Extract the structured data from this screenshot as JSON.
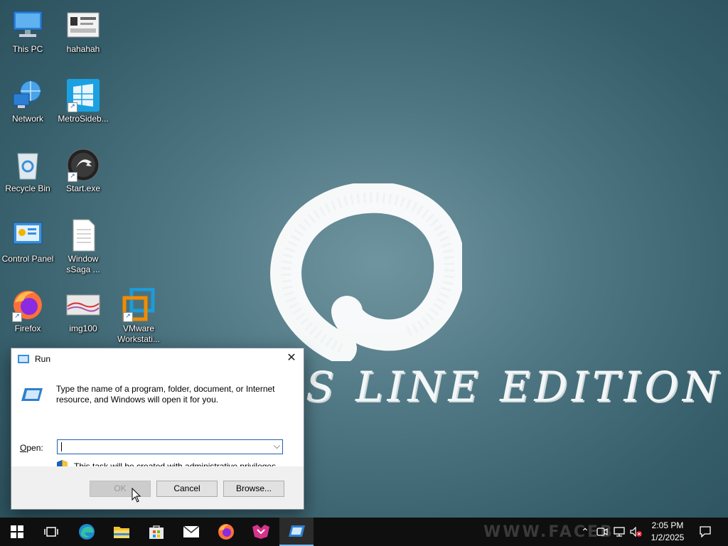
{
  "desktop": {
    "icons": [
      {
        "label": "This PC"
      },
      {
        "label": "hahahah"
      },
      {
        "label": "Network"
      },
      {
        "label": "MetroSideb..."
      },
      {
        "label": "Recycle Bin"
      },
      {
        "label": "Start.exe"
      },
      {
        "label": "Control Panel"
      },
      {
        "label": "Window sSaga ..."
      },
      {
        "label": "Firefox"
      },
      {
        "label": "img100"
      },
      {
        "label": "VMware Workstati..."
      }
    ],
    "watermark_text": "S LINE EDITION"
  },
  "run_dialog": {
    "title": "Run",
    "description": "Type the name of a program, folder, document, or Internet resource, and Windows will open it for you.",
    "open_label_accel": "O",
    "open_label_rest": "pen:",
    "open_value": "",
    "admin_note": "This task will be created with administrative privileges.",
    "ok_label": "OK",
    "cancel_label": "Cancel",
    "browse_label": "Browse..."
  },
  "taskbar": {
    "time": "2:05 PM",
    "date": "1/2/2025",
    "faded_watermark": "WWW.FACEB"
  },
  "icons": {
    "start": "windows-start-icon",
    "task_view": "task-view-icon",
    "edge": "edge-icon",
    "explorer": "file-explorer-icon",
    "store": "store-icon",
    "mail": "mail-icon",
    "firefox": "firefox-icon",
    "app": "pink-app-icon",
    "run": "run-icon"
  },
  "colors": {
    "taskbar": "#0f0f0f",
    "accent": "#1e5fb4",
    "active_underline": "#76b9ed"
  }
}
